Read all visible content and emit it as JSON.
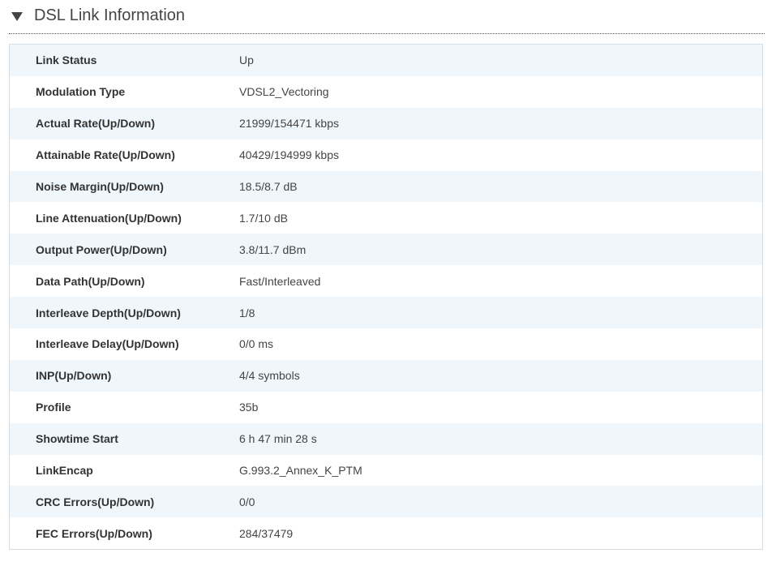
{
  "section": {
    "title": "DSL Link Information",
    "toggle_icon": "triangle-down-icon"
  },
  "rows": [
    {
      "label": "Link Status",
      "value": "Up"
    },
    {
      "label": "Modulation Type",
      "value": "VDSL2_Vectoring"
    },
    {
      "label": "Actual Rate(Up/Down)",
      "value": "21999/154471 kbps"
    },
    {
      "label": "Attainable Rate(Up/Down)",
      "value": "40429/194999 kbps"
    },
    {
      "label": "Noise Margin(Up/Down)",
      "value": "18.5/8.7 dB"
    },
    {
      "label": "Line Attenuation(Up/Down)",
      "value": "1.7/10 dB"
    },
    {
      "label": "Output Power(Up/Down)",
      "value": "3.8/11.7 dBm"
    },
    {
      "label": "Data Path(Up/Down)",
      "value": "Fast/Interleaved"
    },
    {
      "label": "Interleave Depth(Up/Down)",
      "value": "1/8"
    },
    {
      "label": "Interleave Delay(Up/Down)",
      "value": "0/0 ms"
    },
    {
      "label": "INP(Up/Down)",
      "value": "4/4 symbols"
    },
    {
      "label": "Profile",
      "value": "35b"
    },
    {
      "label": "Showtime Start",
      "value": "6 h 47 min 28 s"
    },
    {
      "label": "LinkEncap",
      "value": "G.993.2_Annex_K_PTM"
    },
    {
      "label": "CRC Errors(Up/Down)",
      "value": "0/0"
    },
    {
      "label": "FEC Errors(Up/Down)",
      "value": "284/37479"
    }
  ],
  "colors": {
    "row_alt": "#f0f7fc",
    "row_plain": "#ffffff",
    "border": "#d6dde2",
    "title_text": "#444444"
  }
}
